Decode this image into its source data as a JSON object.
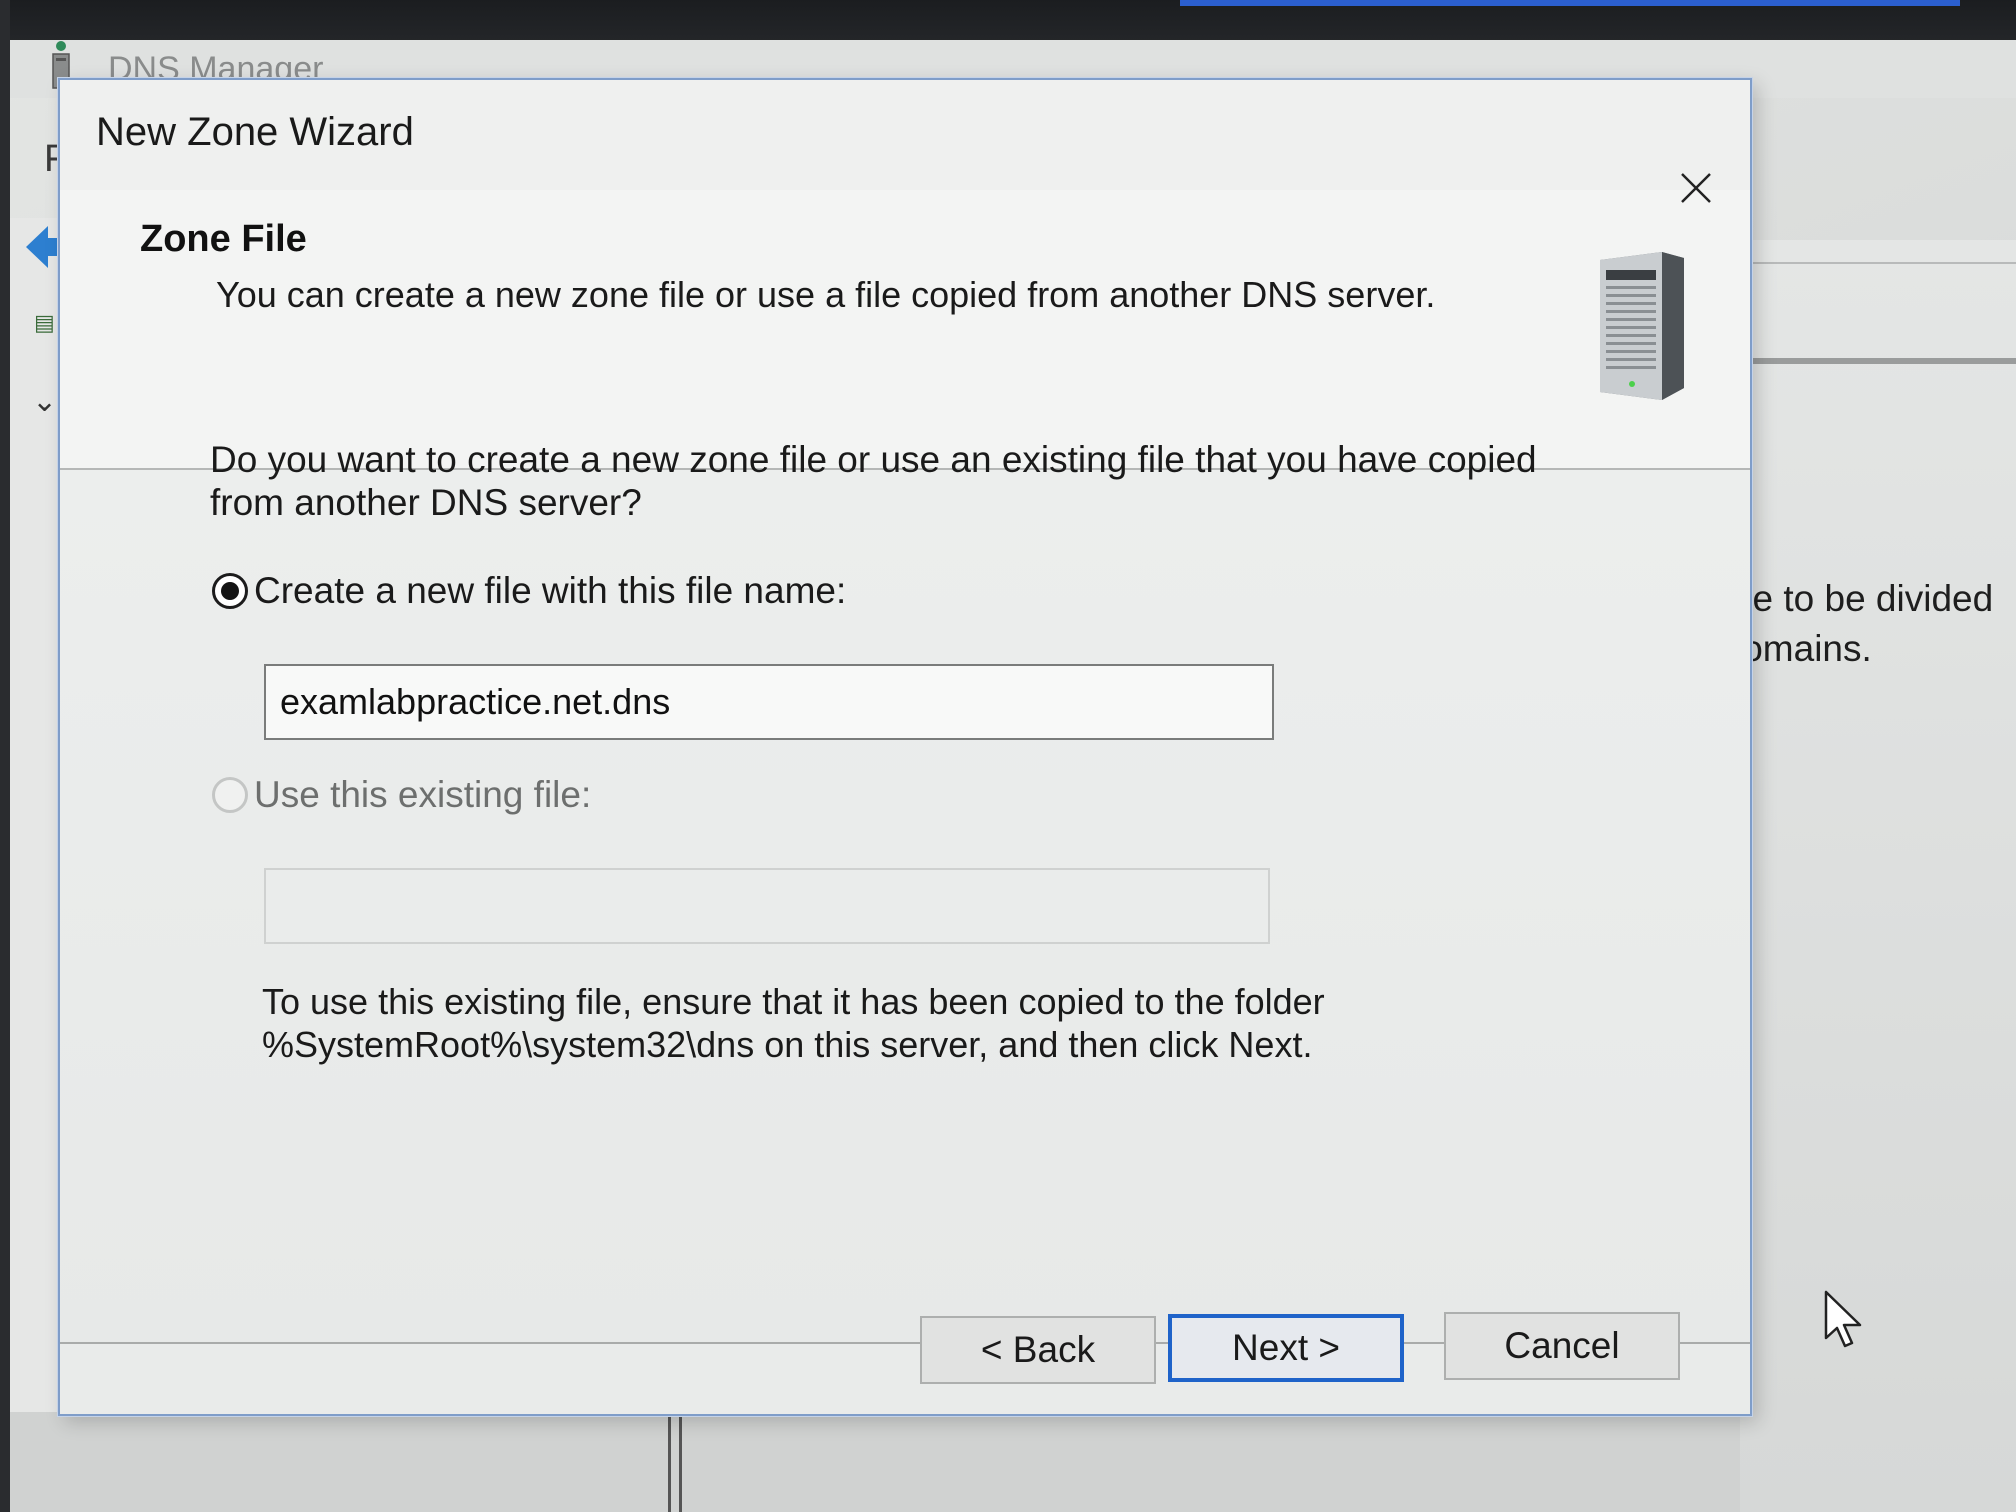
{
  "background": {
    "app_title": "DNS Manager",
    "menu_letter": "F",
    "side_text_line1": "ce to be divided",
    "side_text_line2": "lomains.",
    "side_text_line3": "."
  },
  "dialog": {
    "title": "New Zone Wizard",
    "header": {
      "title": "Zone File",
      "subtitle": "You can create a new zone file or use a file copied from another DNS server.",
      "icon": "server-icon"
    },
    "question": "Do you want to create a new zone file or use an existing file that you have copied from another DNS server?",
    "options": {
      "create_new": {
        "label": "Create a new file with this file name:",
        "selected": true,
        "value": "examlabpractice.net.dns"
      },
      "use_existing": {
        "label": "Use this existing file:",
        "selected": false,
        "enabled": false,
        "value": ""
      }
    },
    "help_text": "To use this existing file, ensure that it has been copied to the folder %SystemRoot%\\system32\\dns on this server, and then click Next.",
    "buttons": {
      "back": "< Back",
      "next": "Next >",
      "cancel": "Cancel"
    }
  },
  "colors": {
    "accent": "#1f63c9",
    "dialog_border": "#7f9dc9",
    "dialog_bg": "#eff0ef"
  }
}
